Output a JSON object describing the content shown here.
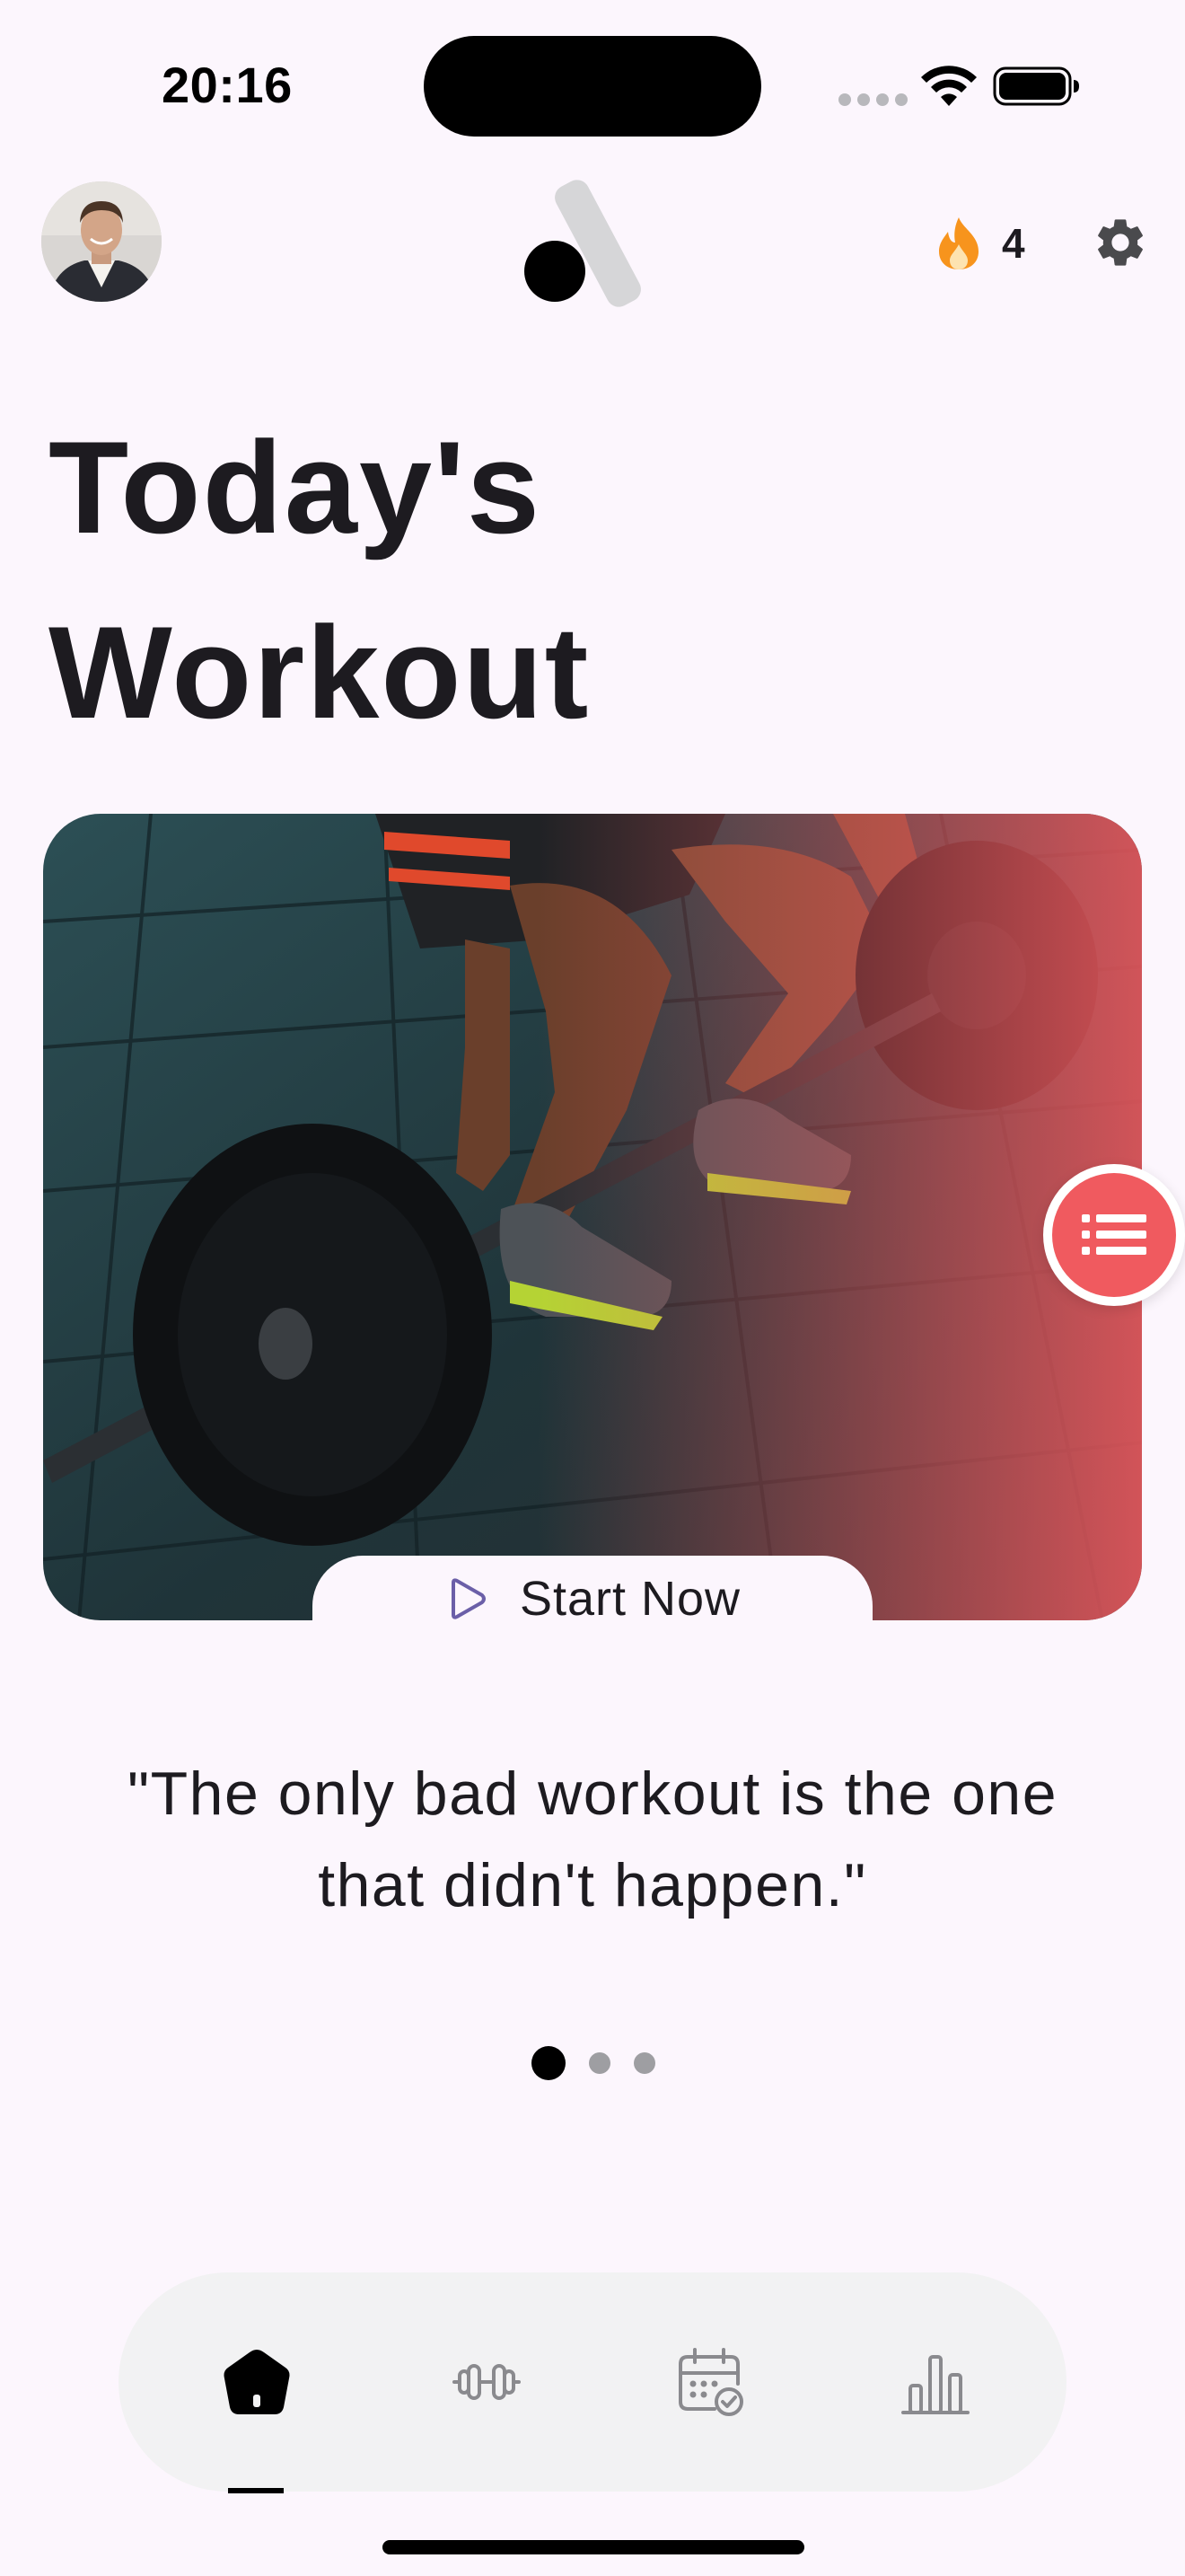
{
  "status_bar": {
    "time": "20:16"
  },
  "header": {
    "avatar": "user-avatar",
    "logo": "app-logo",
    "streak_icon": "flame-icon",
    "streak_count": "4",
    "settings_icon": "gear-icon"
  },
  "title": {
    "line1": "Today's",
    "line2": "Workout"
  },
  "hero": {
    "image": "barbell-deadlift-photo",
    "start_label": "Start Now",
    "start_icon": "play-icon",
    "list_icon": "list-icon"
  },
  "quote": {
    "line1": "\"The only bad workout is the one",
    "line2": "that didn't happen.\""
  },
  "pager": {
    "count": 3,
    "active_index": 0
  },
  "bottom_nav": {
    "items": [
      {
        "icon": "home-icon",
        "active": true
      },
      {
        "icon": "dumbbell-icon",
        "active": false
      },
      {
        "icon": "calendar-check-icon",
        "active": false
      },
      {
        "icon": "bar-chart-icon",
        "active": false
      }
    ]
  },
  "colors": {
    "background": "#fcf6fd",
    "accent_red": "#f05a5f",
    "flame_orange": "#f7941d",
    "nav_background": "#f2f2f3",
    "play_icon_purple": "#6b5fa8"
  }
}
